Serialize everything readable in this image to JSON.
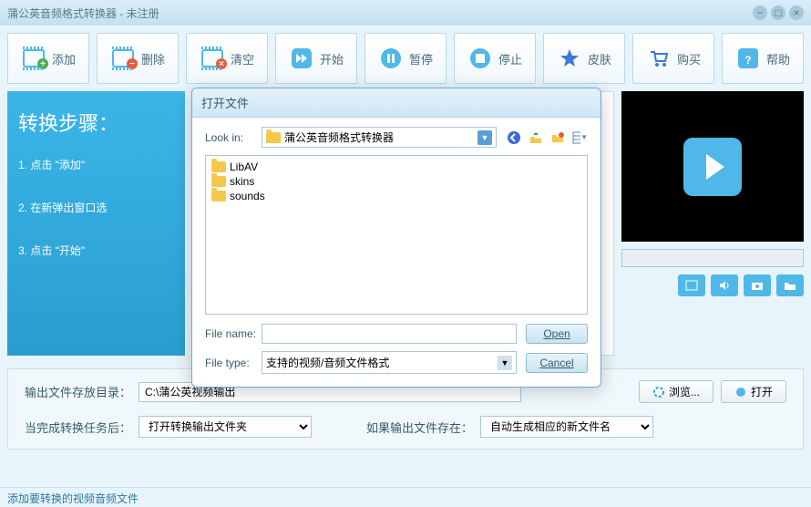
{
  "title": "蒲公英音频格式转换器 - 未注册",
  "toolbar": {
    "add": "添加",
    "delete": "删除",
    "clear": "清空",
    "start": "开始",
    "pause": "暂停",
    "stop": "停止",
    "skin": "皮肤",
    "buy": "购买",
    "help": "帮助"
  },
  "steps": {
    "heading": "转换步骤：",
    "s1": "1. 点击 \"添加\"",
    "s2": "2. 在新弹出窗口选",
    "s3": "3. 点击 \"开始\""
  },
  "bottom": {
    "output_label": "输出文件存放目录：",
    "output_path": "C:\\蒲公英视频输出",
    "browse": "浏览...",
    "open": "打开",
    "after_label": "当完成转换任务后：",
    "after_value": "打开转换输出文件夹",
    "exists_label": "如果输出文件存在：",
    "exists_value": "自动生成相应的新文件名"
  },
  "status": "添加要转换的视频音频文件",
  "dialog": {
    "title": "打开文件",
    "lookin_label": "Look in:",
    "lookin_value": "蒲公英音频格式转换器",
    "files": [
      "LibAV",
      "skins",
      "sounds"
    ],
    "filename_label": "File name:",
    "filename_value": "",
    "filetype_label": "File type:",
    "filetype_value": "支持的视频/音频文件格式",
    "open_btn": "Open",
    "cancel_btn": "Cancel"
  }
}
